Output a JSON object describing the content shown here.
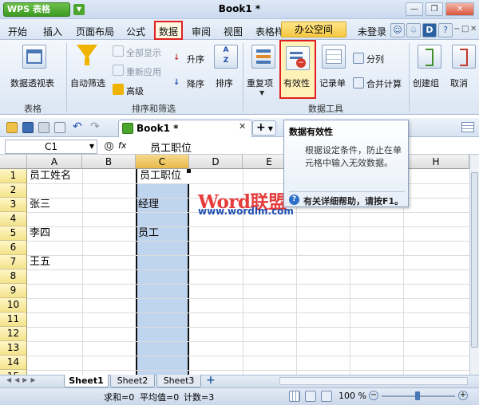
{
  "app": {
    "logo": "WPS 表格",
    "logo_arrow": "▼",
    "doc_title": "Book1 *"
  },
  "window_buttons": {
    "min": "—",
    "restore": "❐",
    "close": "✕",
    "sub_min": "−",
    "sub_restore": "□",
    "sub_close": "✕"
  },
  "menu": [
    "开始",
    "插入",
    "页面布局",
    "公式",
    "数据",
    "审阅",
    "视图",
    "表格样式",
    "办公空间"
  ],
  "menu_right": {
    "login": "未登录",
    "icon_d": "D"
  },
  "ribbon": {
    "pivot": "数据透视表",
    "autofilter": "自动筛选",
    "show_all": "全部显示",
    "reapply": "重新应用",
    "advanced": "高级",
    "sort_asc": "升序",
    "sort_desc": "降序",
    "sort": "排序",
    "duplicates": "重复项",
    "validity": "有效性",
    "record": "记录单",
    "split": "分列",
    "consolidate": "合并计算",
    "create_group": "创建组",
    "ungroup": "取消",
    "group_table": "表格",
    "group_sort": "排序和筛选",
    "group_tools": "数据工具"
  },
  "tabs": {
    "doc_tab": "Book1 *",
    "plus": "+"
  },
  "formula_bar": {
    "namebox": "C1",
    "fx": "fx",
    "formula": "员工职位"
  },
  "columns": [
    "A",
    "B",
    "C",
    "D",
    "E",
    "F",
    "G",
    "H"
  ],
  "rows": [
    "1",
    "2",
    "3",
    "4",
    "5",
    "6",
    "7",
    "8",
    "9",
    "10",
    "11",
    "12",
    "13",
    "14",
    "15"
  ],
  "cells": {
    "A1": "员工姓名",
    "A3": "张三",
    "A5": "李四",
    "A7": "王五",
    "C1": "员工职位",
    "C3": "经理",
    "C5": "员工"
  },
  "watermark": {
    "line1": "Word联盟",
    "line2": "www.wordlm.com"
  },
  "tooltip": {
    "title": "数据有效性",
    "body": "根据设定条件，防止在单元格中输入无效数据。",
    "help": "有关详细帮助，请按F1。"
  },
  "sheets": [
    "Sheet1",
    "Sheet2",
    "Sheet3"
  ],
  "status": {
    "sum": "求和=0",
    "avg": "平均值=0",
    "count": "计数=3",
    "zoom": "100 %"
  },
  "colors": {
    "accent_red": "#e02020",
    "selection": "#bfd4ee",
    "row_header": "#f3e38a"
  }
}
